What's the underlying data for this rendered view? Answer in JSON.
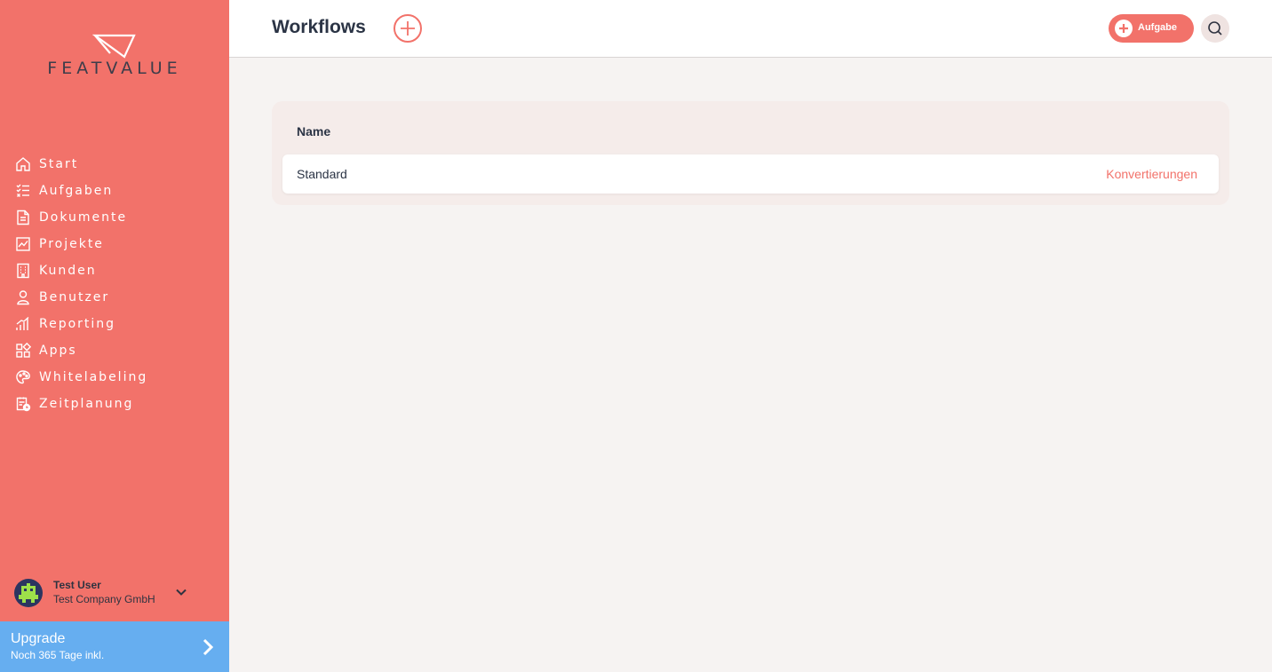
{
  "brand": {
    "logo_text": "FEATVALUE",
    "accent": "#f2726a",
    "upgrade_color": "#66aef0"
  },
  "sidebar": {
    "items": [
      {
        "label": "Start",
        "icon": "home-icon"
      },
      {
        "label": "Aufgaben",
        "icon": "tasks-icon"
      },
      {
        "label": "Dokumente",
        "icon": "document-icon"
      },
      {
        "label": "Projekte",
        "icon": "chart-icon"
      },
      {
        "label": "Kunden",
        "icon": "building-icon"
      },
      {
        "label": "Benutzer",
        "icon": "user-icon"
      },
      {
        "label": "Reporting",
        "icon": "bar-chart-icon"
      },
      {
        "label": "Apps",
        "icon": "apps-icon"
      },
      {
        "label": "Whitelabeling",
        "icon": "palette-icon"
      },
      {
        "label": "Zeitplanung",
        "icon": "calendar-clock-icon"
      }
    ],
    "user": {
      "name": "Test User",
      "company": "Test Company GmbH"
    },
    "upgrade": {
      "title": "Upgrade",
      "subtitle": "Noch 365 Tage inkl."
    }
  },
  "header": {
    "title": "Workflows",
    "task_button_label": "Aufgabe"
  },
  "table": {
    "column_header": "Name",
    "rows": [
      {
        "name": "Standard",
        "action": "Konvertierungen"
      }
    ]
  }
}
